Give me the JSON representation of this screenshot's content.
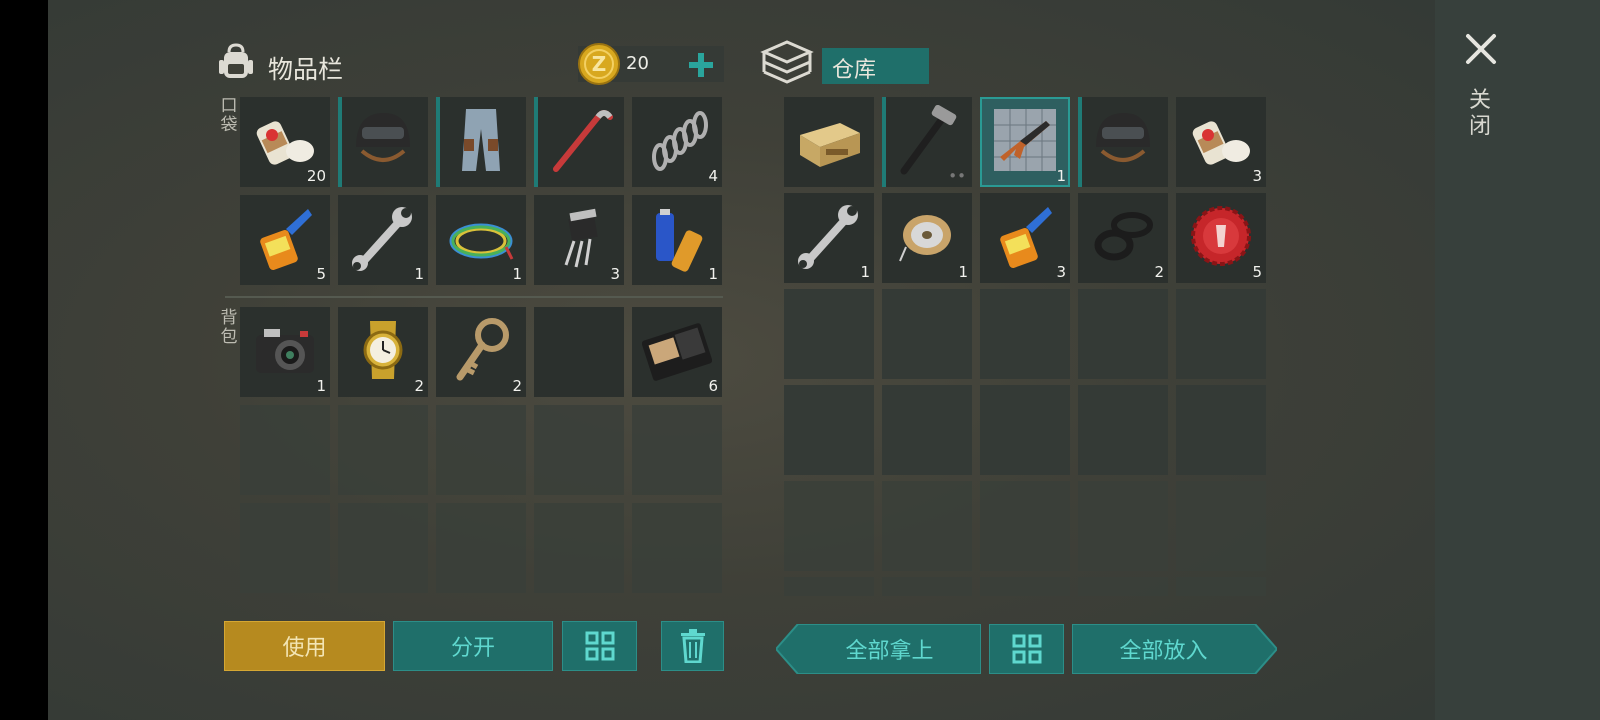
{
  "inventory": {
    "title": "物品栏",
    "coins": "20",
    "pocket_label": "口袋",
    "backpack_label": "背包",
    "pocket_slots": [
      {
        "icon": "bandage-icon",
        "qty": "20"
      },
      {
        "icon": "helmet-icon",
        "qty": ""
      },
      {
        "icon": "pants-icon",
        "qty": ""
      },
      {
        "icon": "crowbar-icon",
        "qty": ""
      },
      {
        "icon": "spring-icon",
        "qty": "4"
      },
      {
        "icon": "glue-icon",
        "qty": "5"
      },
      {
        "icon": "wrench-icon",
        "qty": "1"
      },
      {
        "icon": "wire-icon",
        "qty": "1"
      },
      {
        "icon": "transistor-icon",
        "qty": "3"
      },
      {
        "icon": "battery-icon",
        "qty": "1"
      }
    ],
    "backpack_slots": [
      {
        "icon": "camera-icon",
        "qty": "1"
      },
      {
        "icon": "watch-icon",
        "qty": "2"
      },
      {
        "icon": "key-icon",
        "qty": "2"
      },
      {
        "icon": "",
        "qty": ""
      },
      {
        "icon": "wallet-icon",
        "qty": "6"
      }
    ]
  },
  "storage": {
    "title": "仓库",
    "slots": [
      {
        "icon": "ammo-box-icon",
        "qty": ""
      },
      {
        "icon": "hammer-icon",
        "qty": ""
      },
      {
        "icon": "rifle-blueprint-icon",
        "qty": "1"
      },
      {
        "icon": "helmet-icon",
        "qty": ""
      },
      {
        "icon": "bandage-icon",
        "qty": "3"
      },
      {
        "icon": "wrench-icon",
        "qty": "1"
      },
      {
        "icon": "wire-spool-icon",
        "qty": "1"
      },
      {
        "icon": "glue-icon",
        "qty": "3"
      },
      {
        "icon": "rubber-rings-icon",
        "qty": "2"
      },
      {
        "icon": "bottle-cap-icon",
        "qty": "5"
      }
    ]
  },
  "buttons": {
    "use": "使用",
    "split": "分开",
    "take_all": "全部拿上",
    "put_all": "全部放入"
  },
  "close_label": "关闭",
  "colors": {
    "accent": "#1f6f6a",
    "use_button": "#b68a1f",
    "teal_text": "#5fd8cf"
  }
}
